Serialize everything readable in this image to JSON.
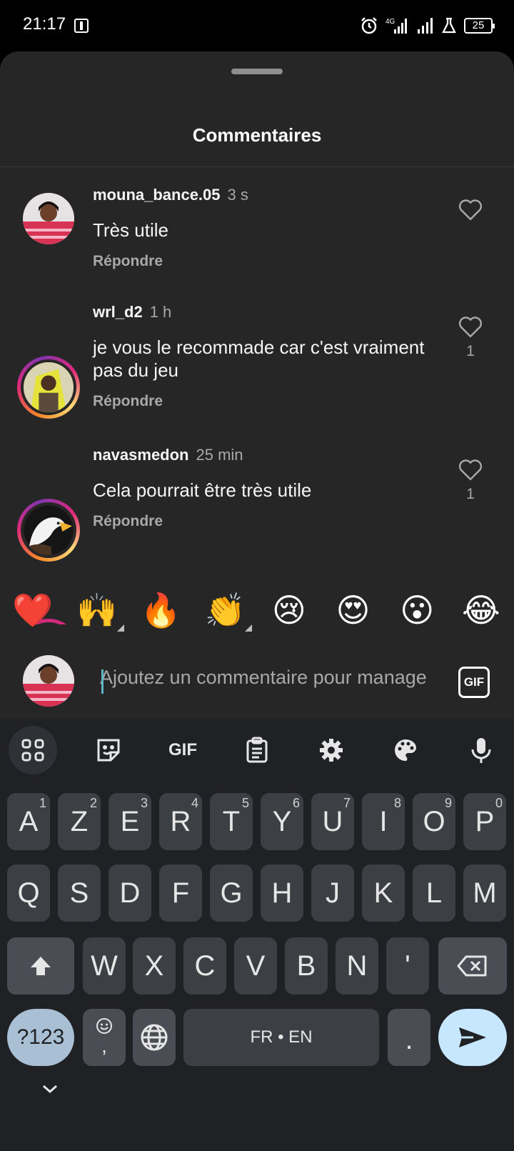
{
  "status_bar": {
    "time": "21:17",
    "battery_level": "25",
    "network": "4G",
    "icons": [
      "alarm-icon",
      "4g-signal-icon",
      "signal-icon",
      "lab-icon",
      "battery-icon"
    ]
  },
  "sheet": {
    "title": "Commentaires"
  },
  "comments": [
    {
      "username": "mouna_bance.05",
      "time": "3 s",
      "text": "Très utile",
      "reply_label": "Répondre",
      "like_count": "",
      "has_story_ring": false
    },
    {
      "username": "wrl_d2",
      "time": "1 h",
      "text": "je vous le recommade car c'est vraiment pas du jeu",
      "reply_label": "Répondre",
      "like_count": "1",
      "has_story_ring": true
    },
    {
      "username": "navasmedon",
      "time": "25 min",
      "text": "Cela pourrait être très utile",
      "reply_label": "Répondre",
      "like_count": "1",
      "has_story_ring": true
    }
  ],
  "emoji_bar": [
    "❤️",
    "🙌",
    "🔥",
    "👏",
    "😢",
    "😍",
    "😮",
    "😂"
  ],
  "composer": {
    "placeholder": "Ajoutez un commentaire pour manage",
    "gif_label": "GIF"
  },
  "keyboard": {
    "toolbar": [
      "apps-grid-icon",
      "sticker-icon",
      "gif-icon",
      "clipboard-icon",
      "settings-icon",
      "theme-palette-icon",
      "microphone-icon"
    ],
    "toolbar_gif_label": "GIF",
    "row1": [
      [
        "A",
        "1"
      ],
      [
        "Z",
        "2"
      ],
      [
        "E",
        "3"
      ],
      [
        "R",
        "4"
      ],
      [
        "T",
        "5"
      ],
      [
        "Y",
        "6"
      ],
      [
        "U",
        "7"
      ],
      [
        "I",
        "8"
      ],
      [
        "O",
        "9"
      ],
      [
        "P",
        "0"
      ]
    ],
    "row2": [
      "Q",
      "S",
      "D",
      "F",
      "G",
      "H",
      "J",
      "K",
      "L",
      "M"
    ],
    "row3": [
      "W",
      "X",
      "C",
      "V",
      "B",
      "N",
      "'"
    ],
    "symbols_label": "?123",
    "emoji_comma_label": ",",
    "space_label": "FR • EN",
    "period_label": "."
  },
  "colors": {
    "sheet_bg": "#262626",
    "keyboard_bg": "#1f2125",
    "key_bg": "#3c3f44",
    "secondary_text": "#a8a8a8",
    "send_key": "#c7e7ff",
    "symbols_key": "#a9bfd4"
  }
}
